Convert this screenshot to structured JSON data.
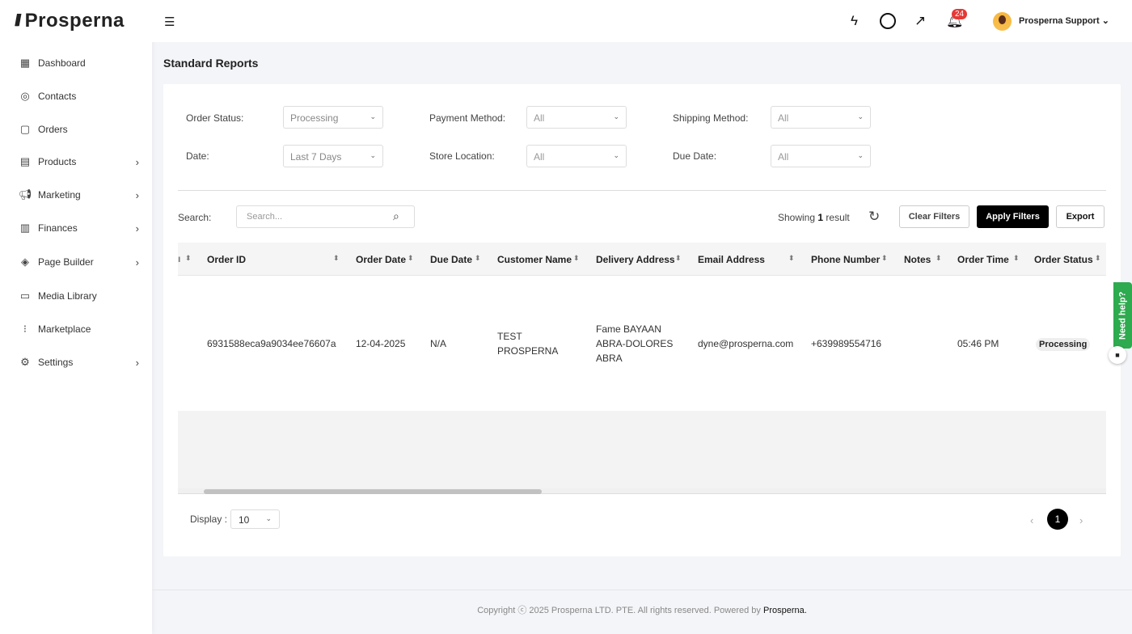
{
  "brand": {
    "name": "Prosperna"
  },
  "sidebar": {
    "items": [
      {
        "label": "Dashboard",
        "icon": "dashboard-icon",
        "chev": false
      },
      {
        "label": "Contacts",
        "icon": "contacts-icon",
        "chev": false
      },
      {
        "label": "Orders",
        "icon": "orders-icon",
        "chev": false
      },
      {
        "label": "Products",
        "icon": "products-icon",
        "chev": true
      },
      {
        "label": "Marketing",
        "icon": "marketing-icon",
        "chev": true
      },
      {
        "label": "Finances",
        "icon": "finances-icon",
        "chev": true
      },
      {
        "label": "Page Builder",
        "icon": "layers-icon",
        "chev": true
      },
      {
        "label": "Media Library",
        "icon": "media-icon",
        "chev": false
      },
      {
        "label": "Marketplace",
        "icon": "marketplace-icon",
        "chev": false
      },
      {
        "label": "Settings",
        "icon": "gear-icon",
        "chev": true
      }
    ]
  },
  "header": {
    "notifications": "24",
    "user": "Prosperna Support"
  },
  "page": {
    "title": "Standard Reports"
  },
  "filters": {
    "order_status": {
      "label": "Order Status:",
      "value": "Processing"
    },
    "payment_method": {
      "label": "Payment Method:",
      "value": "All"
    },
    "shipping_method": {
      "label": "Shipping Method:",
      "value": "All"
    },
    "date": {
      "label": "Date:",
      "value": "Last 7 Days"
    },
    "store_location": {
      "label": "Store Location:",
      "value": "All"
    },
    "due_date": {
      "label": "Due Date:",
      "value": "All"
    }
  },
  "search": {
    "label": "Search:",
    "placeholder": "Search..."
  },
  "results": {
    "prefix": "Showing",
    "count": "1",
    "suffix": "result"
  },
  "buttons": {
    "clear": "Clear Filters",
    "apply": "Apply Filters",
    "export": "Export"
  },
  "table": {
    "columns": [
      "Order ID",
      "Order Date",
      "Due Date",
      "Customer Name",
      "Delivery Address",
      "Email Address",
      "Phone Number",
      "Notes",
      "Order Time",
      "Order Status"
    ],
    "rows": [
      {
        "order_id": "6931588eca9a9034ee76607a",
        "order_date": "12-04-2025",
        "due_date": "N/A",
        "customer": [
          "TEST",
          "PROSPERNA"
        ],
        "address": [
          "Fame BAYAAN",
          "ABRA-DOLORES",
          "ABRA"
        ],
        "email": "dyne@prosperna.com",
        "phone": "+639989554716",
        "notes": "",
        "time": "05:46 PM",
        "status": "Processing"
      }
    ]
  },
  "pagination": {
    "display_label": "Display :",
    "page_size": "10",
    "current_page": "1"
  },
  "help": {
    "label": "Need help?"
  },
  "footer": {
    "text": "Copyright ⓒ 2025 Prosperna LTD. PTE. All rights reserved. Powered by",
    "link": "Prosperna."
  }
}
